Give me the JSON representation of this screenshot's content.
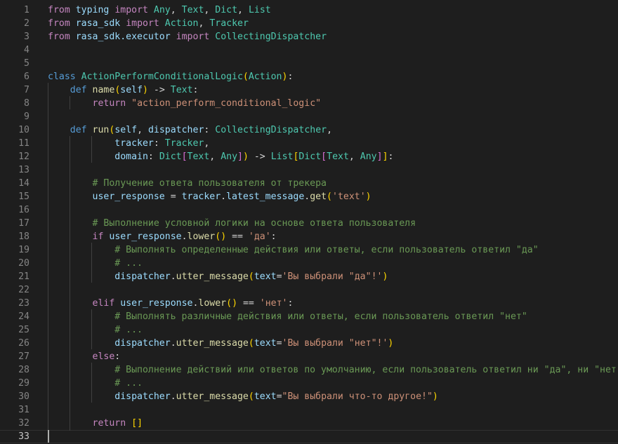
{
  "editor": {
    "language": "python",
    "active_line": 33,
    "lines": [
      {
        "n": "1",
        "tokens": [
          [
            "kw",
            "from"
          ],
          [
            "plain",
            " "
          ],
          [
            "var",
            "typing"
          ],
          [
            "plain",
            " "
          ],
          [
            "kw",
            "import"
          ],
          [
            "plain",
            " "
          ],
          [
            "cls",
            "Any"
          ],
          [
            "plain",
            ", "
          ],
          [
            "cls",
            "Text"
          ],
          [
            "plain",
            ", "
          ],
          [
            "cls",
            "Dict"
          ],
          [
            "plain",
            ", "
          ],
          [
            "cls",
            "List"
          ]
        ]
      },
      {
        "n": "2",
        "tokens": [
          [
            "kw",
            "from"
          ],
          [
            "plain",
            " "
          ],
          [
            "var",
            "rasa_sdk"
          ],
          [
            "plain",
            " "
          ],
          [
            "kw",
            "import"
          ],
          [
            "plain",
            " "
          ],
          [
            "cls",
            "Action"
          ],
          [
            "plain",
            ", "
          ],
          [
            "cls",
            "Tracker"
          ]
        ]
      },
      {
        "n": "3",
        "tokens": [
          [
            "kw",
            "from"
          ],
          [
            "plain",
            " "
          ],
          [
            "var",
            "rasa_sdk.executor"
          ],
          [
            "plain",
            " "
          ],
          [
            "kw",
            "import"
          ],
          [
            "plain",
            " "
          ],
          [
            "cls",
            "CollectingDispatcher"
          ]
        ]
      },
      {
        "n": "4",
        "tokens": []
      },
      {
        "n": "5",
        "tokens": []
      },
      {
        "n": "6",
        "tokens": [
          [
            "st",
            "class"
          ],
          [
            "plain",
            " "
          ],
          [
            "cls",
            "ActionPerformConditionalLogic"
          ],
          [
            "br1",
            "("
          ],
          [
            "cls",
            "Action"
          ],
          [
            "br1",
            ")"
          ],
          [
            "plain",
            ":"
          ]
        ]
      },
      {
        "n": "7",
        "tokens": [
          [
            "plain",
            "    "
          ],
          [
            "st",
            "def"
          ],
          [
            "plain",
            " "
          ],
          [
            "fn",
            "name"
          ],
          [
            "br1",
            "("
          ],
          [
            "var",
            "self"
          ],
          [
            "br1",
            ")"
          ],
          [
            "plain",
            " -> "
          ],
          [
            "cls",
            "Text"
          ],
          [
            "plain",
            ":"
          ]
        ]
      },
      {
        "n": "8",
        "tokens": [
          [
            "plain",
            "        "
          ],
          [
            "kw",
            "return"
          ],
          [
            "plain",
            " "
          ],
          [
            "str",
            "\"action_perform_conditional_logic\""
          ]
        ]
      },
      {
        "n": "9",
        "tokens": []
      },
      {
        "n": "10",
        "tokens": [
          [
            "plain",
            "    "
          ],
          [
            "st",
            "def"
          ],
          [
            "plain",
            " "
          ],
          [
            "fn",
            "run"
          ],
          [
            "br1",
            "("
          ],
          [
            "var",
            "self"
          ],
          [
            "plain",
            ", "
          ],
          [
            "var",
            "dispatcher"
          ],
          [
            "plain",
            ": "
          ],
          [
            "cls",
            "CollectingDispatcher"
          ],
          [
            "plain",
            ","
          ]
        ]
      },
      {
        "n": "11",
        "tokens": [
          [
            "plain",
            "            "
          ],
          [
            "var",
            "tracker"
          ],
          [
            "plain",
            ": "
          ],
          [
            "cls",
            "Tracker"
          ],
          [
            "plain",
            ","
          ]
        ]
      },
      {
        "n": "12",
        "tokens": [
          [
            "plain",
            "            "
          ],
          [
            "var",
            "domain"
          ],
          [
            "plain",
            ": "
          ],
          [
            "cls",
            "Dict"
          ],
          [
            "br2",
            "["
          ],
          [
            "cls",
            "Text"
          ],
          [
            "plain",
            ", "
          ],
          [
            "cls",
            "Any"
          ],
          [
            "br2",
            "]"
          ],
          [
            "br1",
            ")"
          ],
          [
            "plain",
            " -> "
          ],
          [
            "cls",
            "List"
          ],
          [
            "br1",
            "["
          ],
          [
            "cls",
            "Dict"
          ],
          [
            "br2",
            "["
          ],
          [
            "cls",
            "Text"
          ],
          [
            "plain",
            ", "
          ],
          [
            "cls",
            "Any"
          ],
          [
            "br2",
            "]"
          ],
          [
            "br1",
            "]"
          ],
          [
            "plain",
            ":"
          ]
        ]
      },
      {
        "n": "13",
        "tokens": []
      },
      {
        "n": "14",
        "tokens": [
          [
            "plain",
            "        "
          ],
          [
            "cm",
            "# Получение ответа пользователя от трекера"
          ]
        ]
      },
      {
        "n": "15",
        "tokens": [
          [
            "plain",
            "        "
          ],
          [
            "var",
            "user_response"
          ],
          [
            "plain",
            " = "
          ],
          [
            "var",
            "tracker"
          ],
          [
            "plain",
            "."
          ],
          [
            "var",
            "latest_message"
          ],
          [
            "plain",
            "."
          ],
          [
            "fn",
            "get"
          ],
          [
            "br1",
            "("
          ],
          [
            "str",
            "'text'"
          ],
          [
            "br1",
            ")"
          ]
        ]
      },
      {
        "n": "16",
        "tokens": []
      },
      {
        "n": "17",
        "tokens": [
          [
            "plain",
            "        "
          ],
          [
            "cm",
            "# Выполнение условной логики на основе ответа пользователя"
          ]
        ]
      },
      {
        "n": "18",
        "tokens": [
          [
            "plain",
            "        "
          ],
          [
            "kw",
            "if"
          ],
          [
            "plain",
            " "
          ],
          [
            "var",
            "user_response"
          ],
          [
            "plain",
            "."
          ],
          [
            "fn",
            "lower"
          ],
          [
            "br1",
            "()"
          ],
          [
            "plain",
            " == "
          ],
          [
            "str",
            "'да'"
          ],
          [
            "plain",
            ":"
          ]
        ]
      },
      {
        "n": "19",
        "tokens": [
          [
            "plain",
            "            "
          ],
          [
            "cm",
            "# Выполнять определенные действия или ответы, если пользователь ответил \"да\""
          ]
        ]
      },
      {
        "n": "20",
        "tokens": [
          [
            "plain",
            "            "
          ],
          [
            "cm",
            "# ..."
          ]
        ]
      },
      {
        "n": "21",
        "tokens": [
          [
            "plain",
            "            "
          ],
          [
            "var",
            "dispatcher"
          ],
          [
            "plain",
            "."
          ],
          [
            "fn",
            "utter_message"
          ],
          [
            "br1",
            "("
          ],
          [
            "var",
            "text"
          ],
          [
            "plain",
            "="
          ],
          [
            "str",
            "'Вы выбрали \"да\"!'"
          ],
          [
            "br1",
            ")"
          ]
        ]
      },
      {
        "n": "22",
        "tokens": []
      },
      {
        "n": "23",
        "tokens": [
          [
            "plain",
            "        "
          ],
          [
            "kw",
            "elif"
          ],
          [
            "plain",
            " "
          ],
          [
            "var",
            "user_response"
          ],
          [
            "plain",
            "."
          ],
          [
            "fn",
            "lower"
          ],
          [
            "br1",
            "()"
          ],
          [
            "plain",
            " == "
          ],
          [
            "str",
            "'нет'"
          ],
          [
            "plain",
            ":"
          ]
        ]
      },
      {
        "n": "24",
        "tokens": [
          [
            "plain",
            "            "
          ],
          [
            "cm",
            "# Выполнять различные действия или ответы, если пользователь ответил \"нет\""
          ]
        ]
      },
      {
        "n": "25",
        "tokens": [
          [
            "plain",
            "            "
          ],
          [
            "cm",
            "# ..."
          ]
        ]
      },
      {
        "n": "26",
        "tokens": [
          [
            "plain",
            "            "
          ],
          [
            "var",
            "dispatcher"
          ],
          [
            "plain",
            "."
          ],
          [
            "fn",
            "utter_message"
          ],
          [
            "br1",
            "("
          ],
          [
            "var",
            "text"
          ],
          [
            "plain",
            "="
          ],
          [
            "str",
            "'Вы выбрали \"нет\"!'"
          ],
          [
            "br1",
            ")"
          ]
        ]
      },
      {
        "n": "27",
        "tokens": [
          [
            "plain",
            "        "
          ],
          [
            "kw",
            "else"
          ],
          [
            "plain",
            ":"
          ]
        ]
      },
      {
        "n": "28",
        "tokens": [
          [
            "plain",
            "            "
          ],
          [
            "cm",
            "# Выполнение действий или ответов по умолчанию, если пользователь ответил ни \"да\", ни \"нет\""
          ]
        ]
      },
      {
        "n": "29",
        "tokens": [
          [
            "plain",
            "            "
          ],
          [
            "cm",
            "# ..."
          ]
        ]
      },
      {
        "n": "30",
        "tokens": [
          [
            "plain",
            "            "
          ],
          [
            "var",
            "dispatcher"
          ],
          [
            "plain",
            "."
          ],
          [
            "fn",
            "utter_message"
          ],
          [
            "br1",
            "("
          ],
          [
            "var",
            "text"
          ],
          [
            "plain",
            "="
          ],
          [
            "str",
            "\"Вы выбрали что-то другое!\""
          ],
          [
            "br1",
            ")"
          ]
        ]
      },
      {
        "n": "31",
        "tokens": []
      },
      {
        "n": "32",
        "tokens": [
          [
            "plain",
            "        "
          ],
          [
            "kw",
            "return"
          ],
          [
            "plain",
            " "
          ],
          [
            "br1",
            "[]"
          ]
        ]
      },
      {
        "n": "33",
        "tokens": []
      }
    ]
  }
}
